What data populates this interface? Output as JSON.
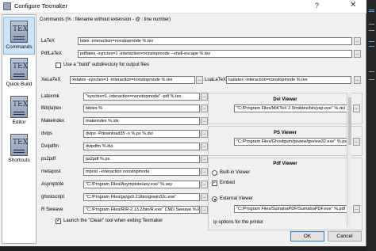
{
  "window": {
    "title": "Configure Texmaker",
    "help_glyph": "?",
    "close_glyph": "✕"
  },
  "sidebar": {
    "items": [
      {
        "label": "Commands",
        "icon": "tex-commands-icon",
        "active": true
      },
      {
        "label": "Quick Build",
        "icon": "tex-quickbuild-icon",
        "active": false
      },
      {
        "label": "Editor",
        "icon": "tex-editor-icon",
        "active": false
      },
      {
        "label": "Shortcuts",
        "icon": "tex-shortcuts-icon",
        "active": false
      }
    ],
    "tex_glyph": "TEX"
  },
  "header": {
    "text": "Commands (% : filename without extension - @ : line number)"
  },
  "top_commands": {
    "latex": {
      "label": "LaTeX",
      "value": "latex -interaction=nonstopmode %.tex"
    },
    "pdflatex": {
      "label": "PdfLaTeX",
      "value": "pdflatex -synctex=1 -interaction=nonstopmode --shell-escape %.tex"
    },
    "build_subdir": {
      "label": "Use a \"build\" subdirectory for output files",
      "checked": false
    },
    "xelatex": {
      "label": "XeLaTeX",
      "value": "xelatex -synctex=1 -interaction=nonstopmode %.tex"
    },
    "lualatex": {
      "label": "LuaLaTeX",
      "value": "lualatex -interaction=nonstopmode %.tex"
    }
  },
  "left_commands": [
    {
      "label": "Latexmk",
      "value": "\"synctex=1 -interaction=nonstopmode\" -pdf %.tex"
    },
    {
      "label": "Bib(la)tex",
      "value": "bibtex %"
    },
    {
      "label": "Makeindex",
      "value": "makeindex %.idx"
    },
    {
      "label": "dvips",
      "value": "dvips -Pdownload35 -o %.ps %.dvi"
    },
    {
      "label": "Dvipdfm",
      "value": "dvipdfm %.dvi"
    },
    {
      "label": "ps2pdf",
      "value": "ps2pdf %.ps"
    },
    {
      "label": "metapost",
      "value": "mpost --interaction nonstopmode"
    },
    {
      "label": "Asymptote",
      "value": "\"C:/Program Files/Asymptote/asy.exe\" %.asy"
    },
    {
      "label": "ghostscript",
      "value": "\"C:/Program Files/gs/gs9.21/bin/gswin32c.exe\""
    },
    {
      "label": "R Sweave",
      "value": "\"C:/Program Files/R/R-2.13.2/bin/R.exe\" CMD Sweave %.Rnw"
    }
  ],
  "browse_glyph": "...",
  "clean_option": {
    "label": "Launch the \"Clean\" tool when exiting Texmaker",
    "checked": true
  },
  "dvi_viewer": {
    "title": "Dvi Viewer",
    "value": "\"C:/Program Files/MiKTeX 2.9/miktex/bin/yap.exe\" %.dvi"
  },
  "ps_viewer": {
    "title": "PS Viewer",
    "value": "\"C:/Program Files/Ghostgum/gsview/gsview32.exe\" %.ps"
  },
  "pdf_viewer": {
    "title": "Pdf Viewer",
    "builtin_label": "Built-in Viewer",
    "embed_label": "Embed",
    "embed_checked": true,
    "external_label": "External Viewer",
    "external_selected": true,
    "value": "\"C:/Program Files/SumatraPDF/SumatraPDF.exe\" %.pdf",
    "printer_label": "ip options for the printer"
  },
  "buttons": {
    "ok": "OK",
    "cancel": "Cancel"
  },
  "colors": {
    "accent": "#2a7bd4",
    "selection": "#cde4f7"
  }
}
